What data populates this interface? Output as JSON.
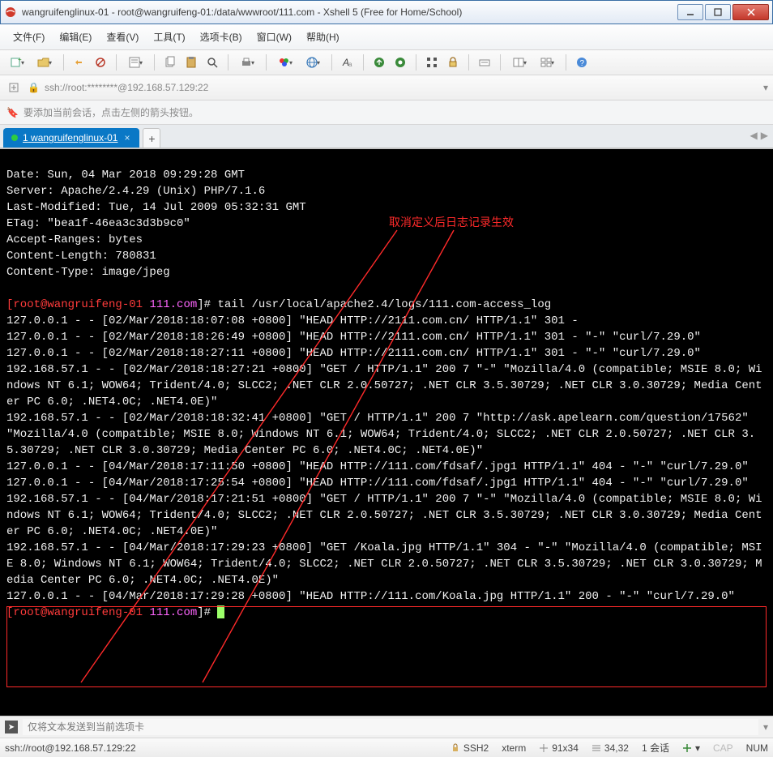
{
  "window": {
    "title": "wangruifenglinux-01 - root@wangruifeng-01:/data/wwwroot/111.com - Xshell 5 (Free for Home/School)"
  },
  "menu": {
    "file": "文件(F)",
    "edit": "编辑(E)",
    "view": "查看(V)",
    "tools": "工具(T)",
    "tabs": "选项卡(B)",
    "window": "窗口(W)",
    "help": "帮助(H)"
  },
  "address": "ssh://root:********@192.168.57.129:22",
  "hint": "要添加当前会话，点击左侧的箭头按钮。",
  "tab": {
    "index": "1",
    "name": "wangruifenglinux-01"
  },
  "annotation": "取消定义后日志记录生效",
  "terminal": {
    "headers": [
      "Date: Sun, 04 Mar 2018 09:29:28 GMT",
      "Server: Apache/2.4.29 (Unix) PHP/7.1.6",
      "Last-Modified: Tue, 14 Jul 2009 05:32:31 GMT",
      "ETag: \"bea1f-46ea3c3d3b9c0\"",
      "Accept-Ranges: bytes",
      "Content-Length: 780831",
      "Content-Type: image/jpeg"
    ],
    "prompt1_user": "[root@wangruifeng-01 ",
    "prompt1_dir": "111.com",
    "prompt1_cmd": "]# tail /usr/local/apache2.4/logs/111.com-access_log",
    "log_lines": [
      "127.0.0.1 - - [02/Mar/2018:18:07:08 +0800] \"HEAD HTTP://2111.com.cn/ HTTP/1.1\" 301 -",
      "127.0.0.1 - - [02/Mar/2018:18:26:49 +0800] \"HEAD HTTP://2111.com.cn/ HTTP/1.1\" 301 - \"-\" \"curl/7.29.0\"",
      "127.0.0.1 - - [02/Mar/2018:18:27:11 +0800] \"HEAD HTTP://2111.com.cn/ HTTP/1.1\" 301 - \"-\" \"curl/7.29.0\"",
      "192.168.57.1 - - [02/Mar/2018:18:27:21 +0800] \"GET / HTTP/1.1\" 200 7 \"-\" \"Mozilla/4.0 (compatible; MSIE 8.0; Windows NT 6.1; WOW64; Trident/4.0; SLCC2; .NET CLR 2.0.50727; .NET CLR 3.5.30729; .NET CLR 3.0.30729; Media Center PC 6.0; .NET4.0C; .NET4.0E)\"",
      "192.168.57.1 - - [02/Mar/2018:18:32:41 +0800] \"GET / HTTP/1.1\" 200 7 \"http://ask.apelearn.com/question/17562\" \"Mozilla/4.0 (compatible; MSIE 8.0; Windows NT 6.1; WOW64; Trident/4.0; SLCC2; .NET CLR 2.0.50727; .NET CLR 3.5.30729; .NET CLR 3.0.30729; Media Center PC 6.0; .NET4.0C; .NET4.0E)\"",
      "127.0.0.1 - - [04/Mar/2018:17:11:50 +0800] \"HEAD HTTP://111.com/fdsaf/.jpg1 HTTP/1.1\" 404 - \"-\" \"curl/7.29.0\"",
      "127.0.0.1 - - [04/Mar/2018:17:25:54 +0800] \"HEAD HTTP://111.com/fdsaf/.jpg1 HTTP/1.1\" 404 - \"-\" \"curl/7.29.0\"",
      "192.168.57.1 - - [04/Mar/2018:17:21:51 +0800] \"GET / HTTP/1.1\" 200 7 \"-\" \"Mozilla/4.0 (compatible; MSIE 8.0; Windows NT 6.1; WOW64; Trident/4.0; SLCC2; .NET CLR 2.0.50727; .NET CLR 3.5.30729; .NET CLR 3.0.30729; Media Center PC 6.0; .NET4.0C; .NET4.0E)\""
    ],
    "boxed_lines": [
      "192.168.57.1 - - [04/Mar/2018:17:29:23 +0800] \"GET /Koala.jpg HTTP/1.1\" 304 - \"-\" \"Mozilla/4.0 (compatible; MSIE 8.0; Windows NT 6.1; WOW64; Trident/4.0; SLCC2; .NET CLR 2.0.50727; .NET CLR 3.5.30729; .NET CLR 3.0.30729; Media Center PC 6.0; .NET4.0C; .NET4.0E)\"",
      "127.0.0.1 - - [04/Mar/2018:17:29:28 +0800] \"HEAD HTTP://111.com/Koala.jpg HTTP/1.1\" 200 - \"-\" \"curl/7.29.0\""
    ],
    "prompt2_user": "[root@wangruifeng-01 ",
    "prompt2_dir": "111.com",
    "prompt2_end": "]# "
  },
  "footer_input_placeholder": "仅将文本发送到当前选项卡",
  "status": {
    "conn": "ssh://root@192.168.57.129:22",
    "ssh": "SSH2",
    "type": "xterm",
    "size": "91x34",
    "pos": "34,32",
    "sess": "1 会话",
    "caps": "CAP",
    "num": "NUM"
  }
}
